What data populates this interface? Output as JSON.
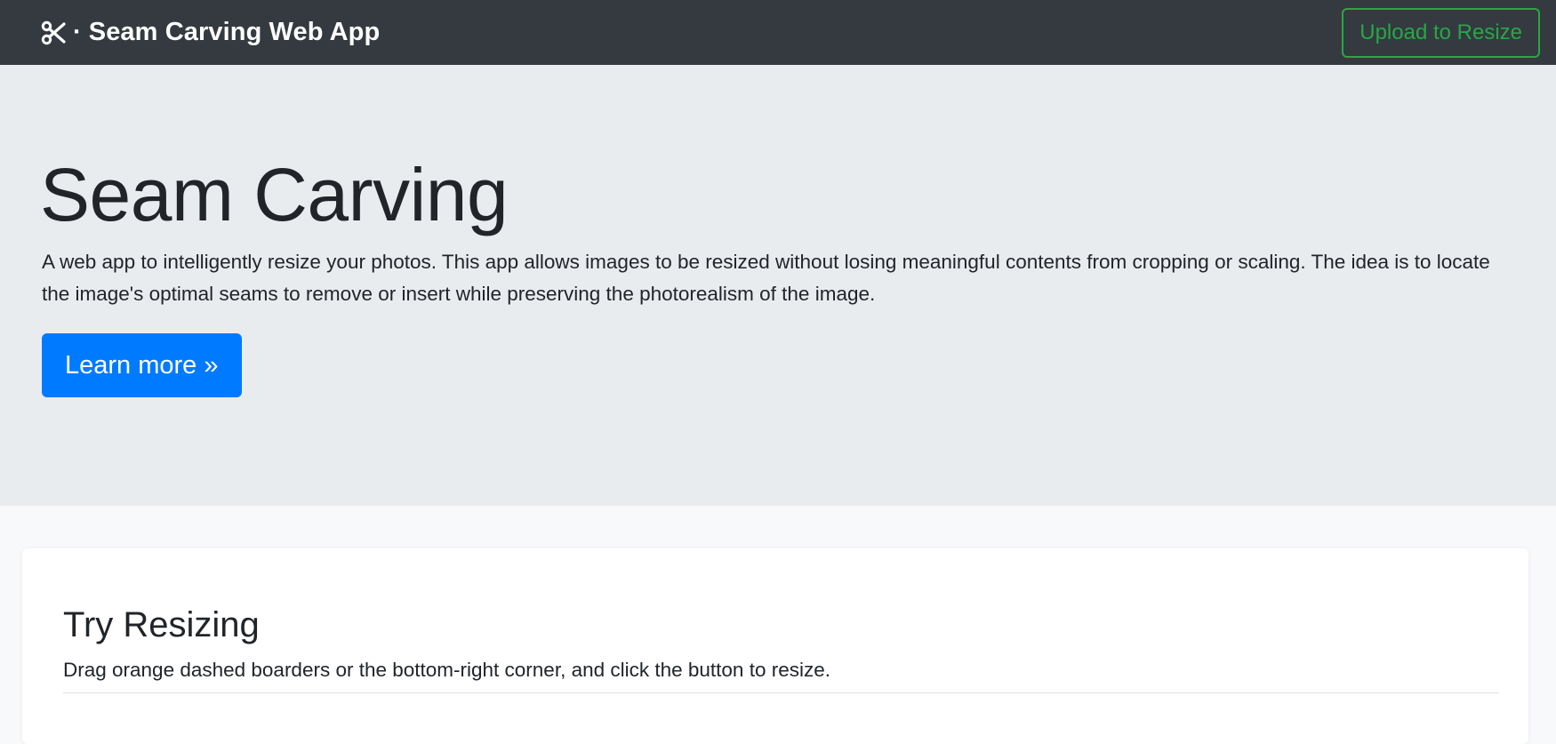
{
  "navbar": {
    "brand_icon": "scissors-icon",
    "brand_separator": "·",
    "brand_text": "Seam Carving Web App",
    "upload_label": "Upload to Resize"
  },
  "hero": {
    "title": "Seam Carving",
    "description": "A web app to intelligently resize your photos. This app allows images to be resized without losing meaningful contents from cropping or scaling. The idea is to locate the image's optimal seams to remove or insert while preserving the photorealism of the image.",
    "learn_more_label": "Learn more »"
  },
  "try_resizing": {
    "title": "Try Resizing",
    "instructions": "Drag orange dashed boarders or the bottom-right corner, and click the button to resize."
  },
  "colors": {
    "navbar_bg": "#343a40",
    "hero_bg": "#e9ecef",
    "primary": "#007bff",
    "success": "#28a745",
    "page_bg": "#f8f9fa"
  }
}
